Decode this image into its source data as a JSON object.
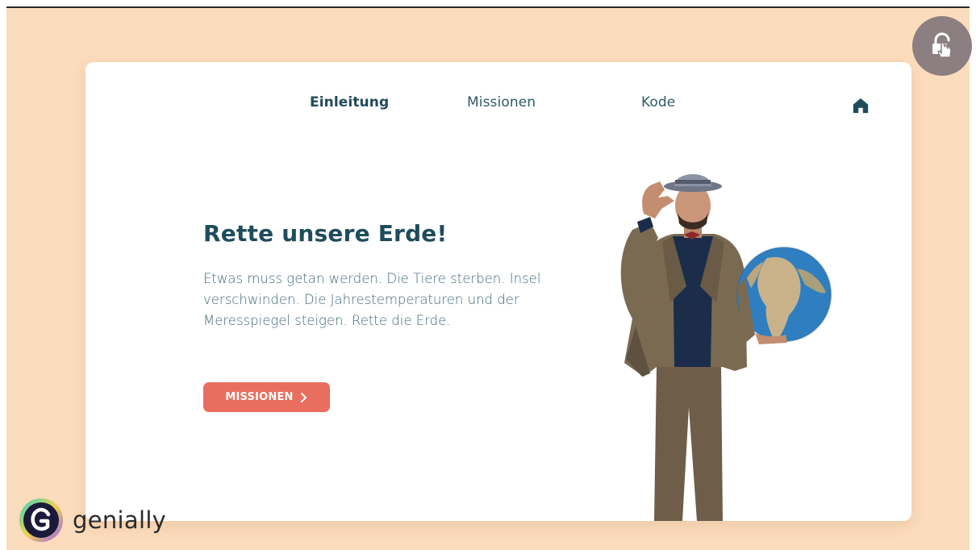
{
  "nav": {
    "items": [
      {
        "label": "Einleitung",
        "active": true
      },
      {
        "label": "Missionen",
        "active": false
      },
      {
        "label": "Kode",
        "active": false
      }
    ],
    "home_icon": "home-icon"
  },
  "hero": {
    "title": "Rette unsere Erde!",
    "description": "Etwas muss getan werden. Die Tiere sterben. Insel verschwinden. Die Jahrestemperaturen und der Meresspiegel steigen. Rette die Erde.",
    "cta_label": "MISSIONEN",
    "cta_icon": "chevron-right-icon"
  },
  "overlay": {
    "unlock_icon": "unlock-pointer-icon",
    "brand_name": "genially"
  },
  "colors": {
    "background": "#fbdcbc",
    "card": "#ffffff",
    "title": "#1f4c5c",
    "text": "#3f6a78",
    "cta": "#e86f5f",
    "lock_button": "#8c7f81"
  }
}
